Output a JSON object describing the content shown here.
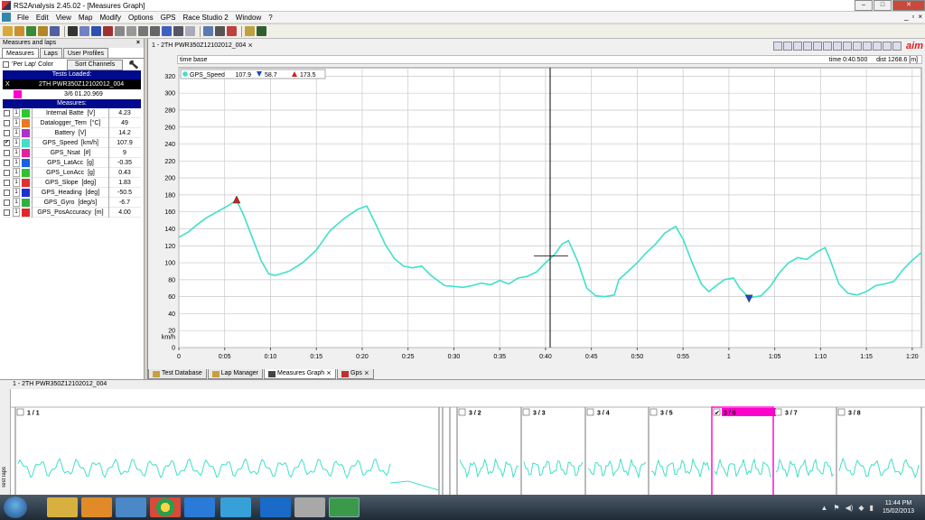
{
  "window": {
    "title": "RS2Analysis 2.45.02 - [Measures Graph]",
    "min": "–",
    "max": "□",
    "close": "✕"
  },
  "menu": [
    "File",
    "Edit",
    "View",
    "Map",
    "Modify",
    "Options",
    "GPS",
    "Race Studio 2",
    "Window",
    "?"
  ],
  "mdi_buttons": {
    "min": "_",
    "restore": "▫",
    "close": "×"
  },
  "left_panel": {
    "title": "Measures and laps",
    "close": "×",
    "tabs": [
      "Measures",
      "Laps",
      "User Profiles"
    ],
    "per_lap_label": "'Per Lap' Color",
    "sort_label": "Sort Channels",
    "tests_loaded_header": "Tests Loaded:",
    "test": {
      "x": "X",
      "name": "2TH PWR350Z12102012_004"
    },
    "lap": "3/6 01.20.969",
    "measures_header": "Measures:",
    "measures": [
      {
        "n": "1",
        "color": "#2ec82e",
        "name": "Internal Batte",
        "unit": "[V]",
        "value": "4.23",
        "checked": false
      },
      {
        "n": "1",
        "color": "#e87820",
        "name": "Datalogger_Tem",
        "unit": "[°C]",
        "value": "49",
        "checked": false
      },
      {
        "n": "1",
        "color": "#b030c8",
        "name": "Battery",
        "unit": "[V]",
        "value": "14.2",
        "checked": false
      },
      {
        "n": "1",
        "color": "#40e0c8",
        "name": "GPS_Speed",
        "unit": "[km/h]",
        "value": "107.9",
        "checked": true
      },
      {
        "n": "1",
        "color": "#e020a0",
        "name": "GPS_Nsat",
        "unit": "[#]",
        "value": "9",
        "checked": false
      },
      {
        "n": "1",
        "color": "#1860e0",
        "name": "GPS_LatAcc",
        "unit": "[g]",
        "value": "-0.35",
        "checked": false
      },
      {
        "n": "1",
        "color": "#30c030",
        "name": "GPS_LonAcc",
        "unit": "[g]",
        "value": "0.43",
        "checked": false
      },
      {
        "n": "1",
        "color": "#e03030",
        "name": "GPS_Slope",
        "unit": "[deg]",
        "value": "1.83",
        "checked": false
      },
      {
        "n": "1",
        "color": "#2030d0",
        "name": "GPS_Heading",
        "unit": "[deg]",
        "value": "-50.5",
        "checked": false
      },
      {
        "n": "1",
        "color": "#30b040",
        "name": "GPS_Gyro",
        "unit": "[deg/s]",
        "value": "-6.7",
        "checked": false
      },
      {
        "n": "1",
        "color": "#e02828",
        "name": "GPS_PosAccuracy",
        "unit": "[m]",
        "value": "4.00",
        "checked": false
      }
    ]
  },
  "graph_window": {
    "tab_label": "1 - 2TH PWR350Z12102012_004",
    "timebase_label": "time base",
    "time_readout": "time 0:40.500",
    "dist_readout": "dist 1268.6 [m]",
    "brand": "aim",
    "legend": {
      "name": "GPS_Speed",
      "value": "107.9",
      "min": "58.7",
      "max": "173.5"
    },
    "bottom_tabs": [
      "Test Database",
      "Lap Manager",
      "Measures Graph",
      "Gps"
    ]
  },
  "chart_data": {
    "type": "line",
    "ylabel": "km/h",
    "ylim": [
      0,
      330
    ],
    "yticks": [
      0,
      20,
      40,
      60,
      80,
      100,
      120,
      140,
      160,
      180,
      200,
      220,
      240,
      260,
      280,
      300,
      320
    ],
    "xlim": [
      0,
      81
    ],
    "xticks": [
      0,
      5,
      10,
      15,
      20,
      25,
      30,
      35,
      40,
      45,
      50,
      55,
      60,
      65,
      70,
      75,
      80
    ],
    "xticklabels": [
      "0",
      "0:05",
      "0:10",
      "0:15",
      "0:20",
      "0:25",
      "0:30",
      "0:35",
      "0:40",
      "0:45",
      "0:50",
      "0:55",
      "1",
      "1:05",
      "1:10",
      "1:15",
      "1:20"
    ],
    "cursor_x": 40.5,
    "cursor_value": 107.9,
    "max_point": [
      6.3,
      173.5
    ],
    "min_point": [
      62.2,
      58.7
    ],
    "series": [
      {
        "color": "#40e0c8",
        "x": [
          0,
          1,
          2,
          3,
          4,
          5,
          6.3,
          7,
          8,
          9,
          9.8,
          10.5,
          12,
          13.5,
          15,
          16.5,
          18,
          19.5,
          20.5,
          21.5,
          22.5,
          23.5,
          24.5,
          25.5,
          26.5,
          27.5,
          29,
          31,
          32,
          33,
          34,
          35,
          36,
          37,
          38,
          39,
          40,
          41,
          41.8,
          42.5,
          43.5,
          44.5,
          45.5,
          46.5,
          47.5,
          48,
          49,
          50,
          51,
          52,
          53,
          54.2,
          55,
          56,
          57,
          57.8,
          58.5,
          59.5,
          60.5,
          61.2,
          62.2,
          63.5,
          64.5,
          65.5,
          66.5,
          67.5,
          68.5,
          69.5,
          70.5,
          71,
          72,
          73,
          74,
          75,
          76,
          77,
          78,
          79,
          80,
          81
        ],
        "y": [
          130,
          136,
          145,
          153,
          159,
          165,
          173.5,
          158,
          130,
          102,
          87,
          85,
          90,
          100,
          115,
          138,
          152,
          163,
          167,
          145,
          122,
          105,
          96,
          94,
          96,
          85,
          73,
          71,
          73,
          76,
          74,
          79,
          75,
          82,
          84,
          89,
          100,
          110,
          122,
          126,
          102,
          70,
          61,
          60,
          62,
          80,
          90,
          100,
          112,
          122,
          135,
          143,
          128,
          100,
          75,
          66,
          72,
          80,
          82,
          70,
          58.7,
          61,
          72,
          88,
          100,
          106,
          104,
          112,
          118,
          105,
          75,
          64,
          62,
          66,
          73,
          75,
          78,
          92,
          103,
          112
        ]
      }
    ]
  },
  "laps_panel": {
    "tab_label": "1 - 2TH PWR350Z12102012_004",
    "side_label": "Test laps",
    "laps": [
      "1 / 1",
      "3 / 2",
      "3 / 3",
      "3 / 4",
      "3 / 5",
      "3 / 6",
      "3 / 7",
      "3 / 8"
    ],
    "selected_lap": "3 / 6"
  },
  "taskbar": {
    "time": "11:44 PM",
    "date": "15/02/2013"
  }
}
